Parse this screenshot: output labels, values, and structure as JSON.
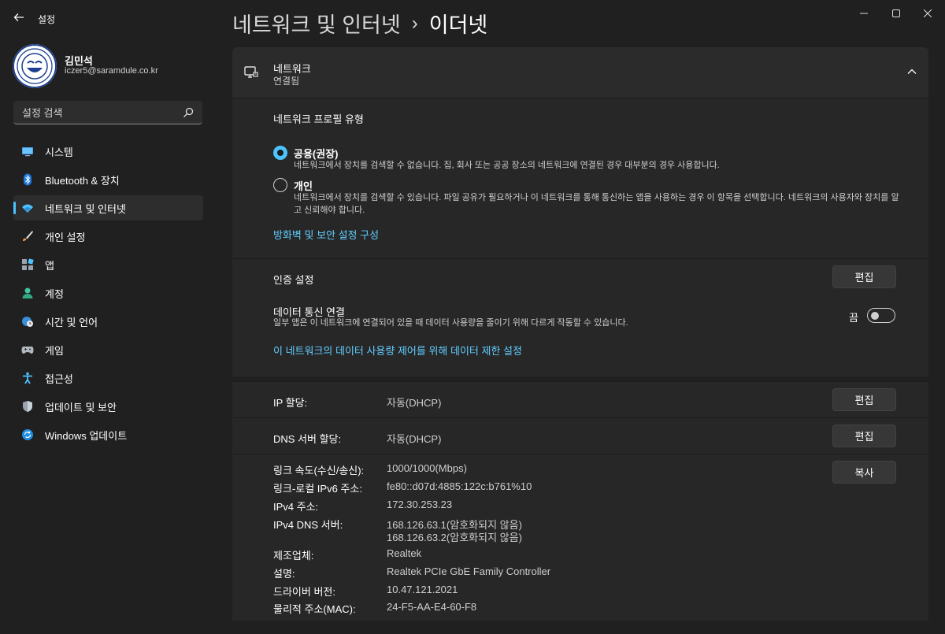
{
  "window": {
    "app_title": "설정",
    "back_icon": "back-arrow-icon",
    "controls": [
      "minimize-icon",
      "maximize-icon",
      "close-icon"
    ]
  },
  "profile": {
    "name": "김민석",
    "email": "iczer5@saramdule.co.kr"
  },
  "search": {
    "placeholder": "설정 검색",
    "icon": "search-icon"
  },
  "sidebar": {
    "items": [
      {
        "label": "시스템",
        "icon": "system-display-icon",
        "active": false
      },
      {
        "label": "Bluetooth & 장치",
        "icon": "bluetooth-icon",
        "active": false
      },
      {
        "label": "네트워크 및 인터넷",
        "icon": "wifi-icon",
        "active": true
      },
      {
        "label": "개인 설정",
        "icon": "brush-icon",
        "active": false
      },
      {
        "label": "앱",
        "icon": "apps-icon",
        "active": false
      },
      {
        "label": "계정",
        "icon": "person-icon",
        "active": false
      },
      {
        "label": "시간 및 언어",
        "icon": "globe-clock-icon",
        "active": false
      },
      {
        "label": "게임",
        "icon": "gamepad-icon",
        "active": false
      },
      {
        "label": "접근성",
        "icon": "accessibility-icon",
        "active": false
      },
      {
        "label": "업데이트 및 보안",
        "icon": "shield-icon",
        "active": false
      },
      {
        "label": "Windows 업데이트",
        "icon": "refresh-icon",
        "active": false
      }
    ]
  },
  "header": {
    "parent": "네트워크 및 인터넷",
    "separator": "›",
    "title": "이더넷"
  },
  "network": {
    "title": "네트워크",
    "status": "연결됨",
    "icon": "ethernet-monitor-icon"
  },
  "profile_type": {
    "heading": "네트워크 프로필 유형",
    "options": [
      {
        "label": "공용(권장)",
        "desc": "네트워크에서 장치를 검색할 수 없습니다. 집, 회사 또는 공공 장소의 네트워크에 연결된 경우 대부분의 경우 사용합니다.",
        "selected": true
      },
      {
        "label": "개인",
        "desc": "네트워크에서 장치를 검색할 수 있습니다. 파일 공유가 필요하거나 이 네트워크를 통해 통신하는 앱을 사용하는 경우 이 항목을 선택합니다. 네트워크의 사용자와 장치를 알고 신뢰해야 합니다.",
        "selected": false
      }
    ],
    "firewall_link": "방화벽 및 보안 설정 구성"
  },
  "auth": {
    "label": "인증 설정",
    "button": "편집"
  },
  "metered": {
    "label": "데이터 통신 연결",
    "desc": "일부 앱은 이 네트워크에 연결되어 있을 때 데이터 사용량을 줄이기 위해 다르게 작동할 수 있습니다.",
    "toggle_label": "끔",
    "toggle_on": false,
    "link": "이 네트워크의 데이터 사용량 제어를 위해 데이터 제한 설정"
  },
  "ip": {
    "label": "IP 할당:",
    "value": "자동(DHCP)",
    "button": "편집"
  },
  "dns": {
    "label": "DNS 서버 할당:",
    "value": "자동(DHCP)",
    "button": "편집"
  },
  "properties": {
    "copy_button": "복사",
    "rows": [
      {
        "key": "링크 속도(수신/송신):",
        "value": "1000/1000(Mbps)"
      },
      {
        "key": "링크-로컬 IPv6 주소:",
        "value": "fe80::d07d:4885:122c:b761%10"
      },
      {
        "key": "IPv4 주소:",
        "value": "172.30.253.23"
      },
      {
        "key": "IPv4 DNS 서버:",
        "value": "168.126.63.1(암호화되지 않음)",
        "value2": "168.126.63.2(암호화되지 않음)"
      },
      {
        "key": "제조업체:",
        "value": "Realtek"
      },
      {
        "key": "설명:",
        "value": "Realtek PCIe GbE Family Controller"
      },
      {
        "key": "드라이버 버전:",
        "value": "10.47.121.2021"
      },
      {
        "key": "물리적 주소(MAC):",
        "value": "24-F5-AA-E4-60-F8"
      }
    ]
  },
  "colors": {
    "background": "#202020",
    "card": "#2b2b2b",
    "accent": "#4cc2ff",
    "link": "#60cdff"
  }
}
